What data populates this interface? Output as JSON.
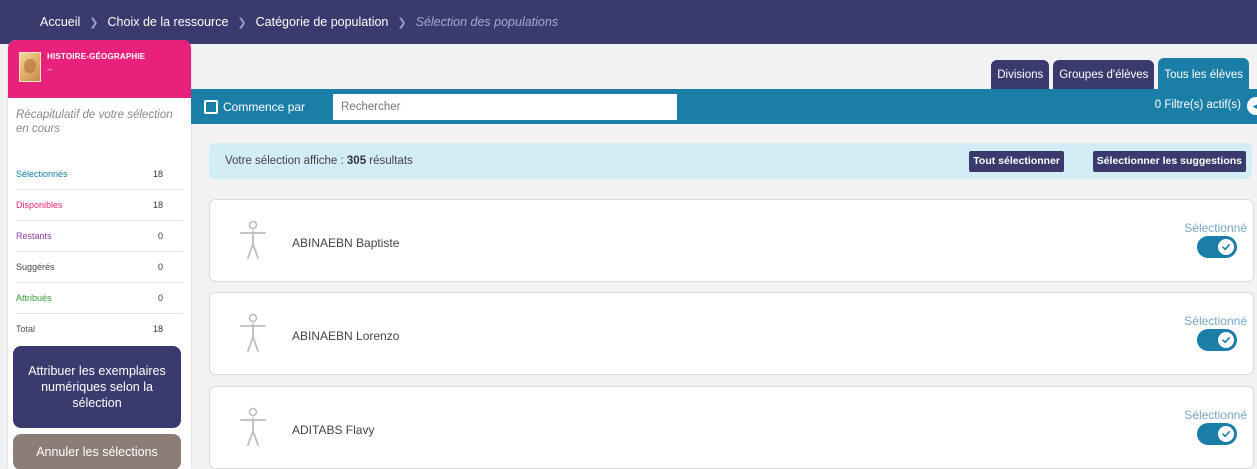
{
  "breadcrumb": {
    "items": [
      "Accueil",
      "Choix de la ressource",
      "Catégorie de population"
    ],
    "current": "Sélection des populations"
  },
  "sidebar": {
    "subject_title": "HISTOIRE-GÉOGRAPHIE",
    "subject_sub": "--",
    "recap": "Récapitulatif de votre sélection en cours",
    "stats": [
      {
        "label": "Sélectionnés",
        "value": "18",
        "color": "#1a7ea6"
      },
      {
        "label": "Disponibles",
        "value": "18",
        "color": "#e8227a"
      },
      {
        "label": "Restants",
        "value": "0",
        "color": "#8a3fa0"
      },
      {
        "label": "Suggérés",
        "value": "0",
        "color": "#444444"
      },
      {
        "label": "Attribués",
        "value": "0",
        "color": "#3a9a3a"
      },
      {
        "label": "Total",
        "value": "18",
        "color": "#555555"
      }
    ],
    "attrib_button": "Attribuer les exemplaires numériques selon la sélection",
    "cancel_button": "Annuler les sélections"
  },
  "tabs": [
    {
      "label": "Divisions",
      "active": false
    },
    {
      "label": "Groupes d'élèves",
      "active": false
    },
    {
      "label": "Tous les élèves",
      "active": true
    }
  ],
  "filter": {
    "checkbox_label": "Commence par",
    "search_placeholder": "Rechercher",
    "filters_active": "0 Filtre(s) actif(s)"
  },
  "results": {
    "prefix": "Votre sélection affiche :",
    "count": "305",
    "suffix": "résultats",
    "select_all": "Tout sélectionner",
    "select_suggestions": "Sélectionner les suggestions"
  },
  "students": [
    {
      "name": "ABINAEBN Baptiste",
      "status": "Sélectionné",
      "selected": true
    },
    {
      "name": "ABINAEBN Lorenzo",
      "status": "Sélectionné",
      "selected": true
    },
    {
      "name": "ADITABS Flavy",
      "status": "Sélectionné",
      "selected": true
    }
  ],
  "colors": {
    "navy": "#3b3a6e",
    "pink": "#e8227a",
    "teal": "#1a7ea6",
    "light_blue": "#d3edf7",
    "taupe": "#8e7d77"
  }
}
